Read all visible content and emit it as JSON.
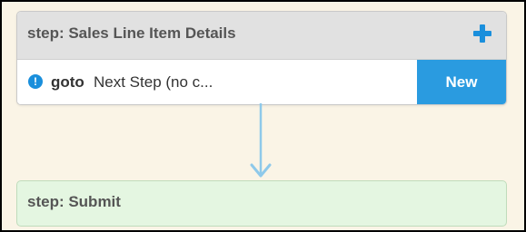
{
  "steps": [
    {
      "title": "step: Sales Line Item Details",
      "add_icon": "plus-icon",
      "goto": {
        "icon": "info-icon",
        "icon_glyph": "!",
        "keyword": "goto",
        "target": "Next Step (no c...",
        "button_label": "New"
      }
    },
    {
      "title": "step: Submit"
    }
  ],
  "colors": {
    "accent": "#1a8fdc",
    "new_button": "#2a9be0",
    "connector": "#8ec9ea",
    "canvas": "#faf4e6",
    "header_bg": "#e1e1e1",
    "submit_bg": "#e4f6e1"
  }
}
